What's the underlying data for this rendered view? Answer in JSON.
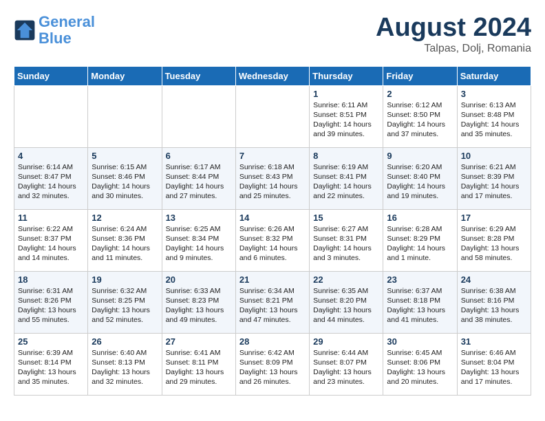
{
  "header": {
    "logo_line1": "General",
    "logo_line2": "Blue",
    "month": "August 2024",
    "location": "Talpas, Dolj, Romania"
  },
  "days_of_week": [
    "Sunday",
    "Monday",
    "Tuesday",
    "Wednesday",
    "Thursday",
    "Friday",
    "Saturday"
  ],
  "weeks": [
    [
      {
        "day": "",
        "content": ""
      },
      {
        "day": "",
        "content": ""
      },
      {
        "day": "",
        "content": ""
      },
      {
        "day": "",
        "content": ""
      },
      {
        "day": "1",
        "content": "Sunrise: 6:11 AM\nSunset: 8:51 PM\nDaylight: 14 hours\nand 39 minutes."
      },
      {
        "day": "2",
        "content": "Sunrise: 6:12 AM\nSunset: 8:50 PM\nDaylight: 14 hours\nand 37 minutes."
      },
      {
        "day": "3",
        "content": "Sunrise: 6:13 AM\nSunset: 8:48 PM\nDaylight: 14 hours\nand 35 minutes."
      }
    ],
    [
      {
        "day": "4",
        "content": "Sunrise: 6:14 AM\nSunset: 8:47 PM\nDaylight: 14 hours\nand 32 minutes."
      },
      {
        "day": "5",
        "content": "Sunrise: 6:15 AM\nSunset: 8:46 PM\nDaylight: 14 hours\nand 30 minutes."
      },
      {
        "day": "6",
        "content": "Sunrise: 6:17 AM\nSunset: 8:44 PM\nDaylight: 14 hours\nand 27 minutes."
      },
      {
        "day": "7",
        "content": "Sunrise: 6:18 AM\nSunset: 8:43 PM\nDaylight: 14 hours\nand 25 minutes."
      },
      {
        "day": "8",
        "content": "Sunrise: 6:19 AM\nSunset: 8:41 PM\nDaylight: 14 hours\nand 22 minutes."
      },
      {
        "day": "9",
        "content": "Sunrise: 6:20 AM\nSunset: 8:40 PM\nDaylight: 14 hours\nand 19 minutes."
      },
      {
        "day": "10",
        "content": "Sunrise: 6:21 AM\nSunset: 8:39 PM\nDaylight: 14 hours\nand 17 minutes."
      }
    ],
    [
      {
        "day": "11",
        "content": "Sunrise: 6:22 AM\nSunset: 8:37 PM\nDaylight: 14 hours\nand 14 minutes."
      },
      {
        "day": "12",
        "content": "Sunrise: 6:24 AM\nSunset: 8:36 PM\nDaylight: 14 hours\nand 11 minutes."
      },
      {
        "day": "13",
        "content": "Sunrise: 6:25 AM\nSunset: 8:34 PM\nDaylight: 14 hours\nand 9 minutes."
      },
      {
        "day": "14",
        "content": "Sunrise: 6:26 AM\nSunset: 8:32 PM\nDaylight: 14 hours\nand 6 minutes."
      },
      {
        "day": "15",
        "content": "Sunrise: 6:27 AM\nSunset: 8:31 PM\nDaylight: 14 hours\nand 3 minutes."
      },
      {
        "day": "16",
        "content": "Sunrise: 6:28 AM\nSunset: 8:29 PM\nDaylight: 14 hours\nand 1 minute."
      },
      {
        "day": "17",
        "content": "Sunrise: 6:29 AM\nSunset: 8:28 PM\nDaylight: 13 hours\nand 58 minutes."
      }
    ],
    [
      {
        "day": "18",
        "content": "Sunrise: 6:31 AM\nSunset: 8:26 PM\nDaylight: 13 hours\nand 55 minutes."
      },
      {
        "day": "19",
        "content": "Sunrise: 6:32 AM\nSunset: 8:25 PM\nDaylight: 13 hours\nand 52 minutes."
      },
      {
        "day": "20",
        "content": "Sunrise: 6:33 AM\nSunset: 8:23 PM\nDaylight: 13 hours\nand 49 minutes."
      },
      {
        "day": "21",
        "content": "Sunrise: 6:34 AM\nSunset: 8:21 PM\nDaylight: 13 hours\nand 47 minutes."
      },
      {
        "day": "22",
        "content": "Sunrise: 6:35 AM\nSunset: 8:20 PM\nDaylight: 13 hours\nand 44 minutes."
      },
      {
        "day": "23",
        "content": "Sunrise: 6:37 AM\nSunset: 8:18 PM\nDaylight: 13 hours\nand 41 minutes."
      },
      {
        "day": "24",
        "content": "Sunrise: 6:38 AM\nSunset: 8:16 PM\nDaylight: 13 hours\nand 38 minutes."
      }
    ],
    [
      {
        "day": "25",
        "content": "Sunrise: 6:39 AM\nSunset: 8:14 PM\nDaylight: 13 hours\nand 35 minutes."
      },
      {
        "day": "26",
        "content": "Sunrise: 6:40 AM\nSunset: 8:13 PM\nDaylight: 13 hours\nand 32 minutes."
      },
      {
        "day": "27",
        "content": "Sunrise: 6:41 AM\nSunset: 8:11 PM\nDaylight: 13 hours\nand 29 minutes."
      },
      {
        "day": "28",
        "content": "Sunrise: 6:42 AM\nSunset: 8:09 PM\nDaylight: 13 hours\nand 26 minutes."
      },
      {
        "day": "29",
        "content": "Sunrise: 6:44 AM\nSunset: 8:07 PM\nDaylight: 13 hours\nand 23 minutes."
      },
      {
        "day": "30",
        "content": "Sunrise: 6:45 AM\nSunset: 8:06 PM\nDaylight: 13 hours\nand 20 minutes."
      },
      {
        "day": "31",
        "content": "Sunrise: 6:46 AM\nSunset: 8:04 PM\nDaylight: 13 hours\nand 17 minutes."
      }
    ]
  ]
}
